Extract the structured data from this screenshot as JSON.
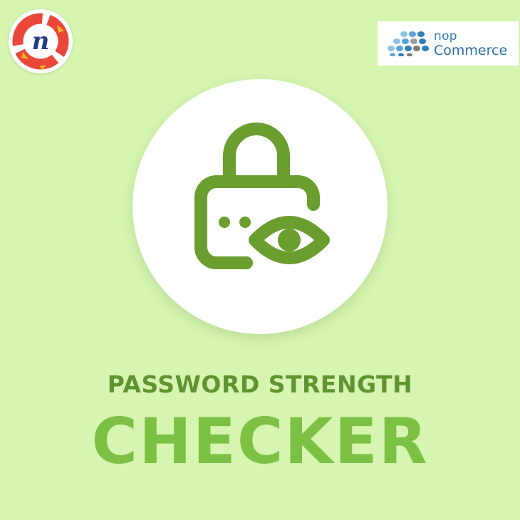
{
  "brand_left": {
    "logo_letter": "n",
    "icon": "brand-n-logo-icon"
  },
  "brand_right": {
    "word1": "nop",
    "word2": "Commerce",
    "icon": "nopcommerce-dots-icon"
  },
  "hero": {
    "icon": "lock-eye-icon"
  },
  "title": {
    "line1": "PASSWORD STRENGTH",
    "line2": "CHECKER"
  },
  "colors": {
    "background": "#d5f5b0",
    "icon_green": "#6a9e2e",
    "title_dark_green": "#5f9430",
    "title_light_green": "#7cc044",
    "logo_red": "#e8473a",
    "logo_yellow": "#f5b81f",
    "nop_blue": "#2f7fb8"
  }
}
